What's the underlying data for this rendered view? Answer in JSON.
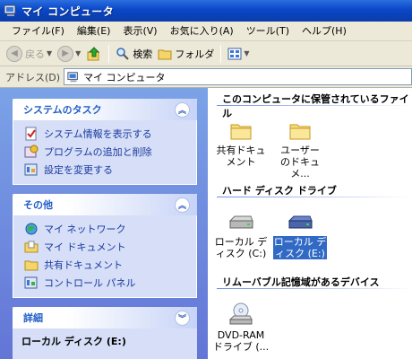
{
  "window": {
    "title": "マイ コンピュータ"
  },
  "menu": [
    "ファイル(F)",
    "編集(E)",
    "表示(V)",
    "お気に入り(A)",
    "ツール(T)",
    "ヘルプ(H)"
  ],
  "toolbar": {
    "back": "戻る",
    "search": "検索",
    "folders": "フォルダ"
  },
  "address": {
    "label": "アドレス(D)",
    "value": "マイ コンピュータ"
  },
  "left": {
    "system_tasks": {
      "title": "システムのタスク",
      "items": [
        "システム情報を表示する",
        "プログラムの追加と削除",
        "設定を変更する"
      ]
    },
    "other": {
      "title": "その他",
      "items": [
        "マイ ネットワーク",
        "マイ ドキュメント",
        "共有ドキュメント",
        "コントロール パネル"
      ]
    },
    "details": {
      "title": "詳細",
      "value": "ローカル ディスク (E:)"
    }
  },
  "right": {
    "groups": [
      {
        "title": "このコンピュータに保管されているファイル",
        "items": [
          {
            "line1": "共有ドキュ",
            "line2": "メント"
          },
          {
            "line1": "ユーザー",
            "line2": "のドキュメ..."
          }
        ]
      },
      {
        "title": "ハード ディスク ドライブ",
        "items": [
          {
            "line1": "ローカル デ",
            "line2": "ィスク (C:)"
          },
          {
            "line1": "ローカル デ",
            "line2": "ィスク (E:)",
            "selected": true
          }
        ]
      },
      {
        "title": "リムーバブル記憶域があるデバイス",
        "items": [
          {
            "line1": "DVD-RAM",
            "line2": "ドライブ (..."
          }
        ]
      }
    ]
  },
  "colors": {
    "titlebar": "#0a47c7",
    "taskpane": "#6375d6",
    "link": "#215dc6",
    "selection": "#316ac5"
  }
}
